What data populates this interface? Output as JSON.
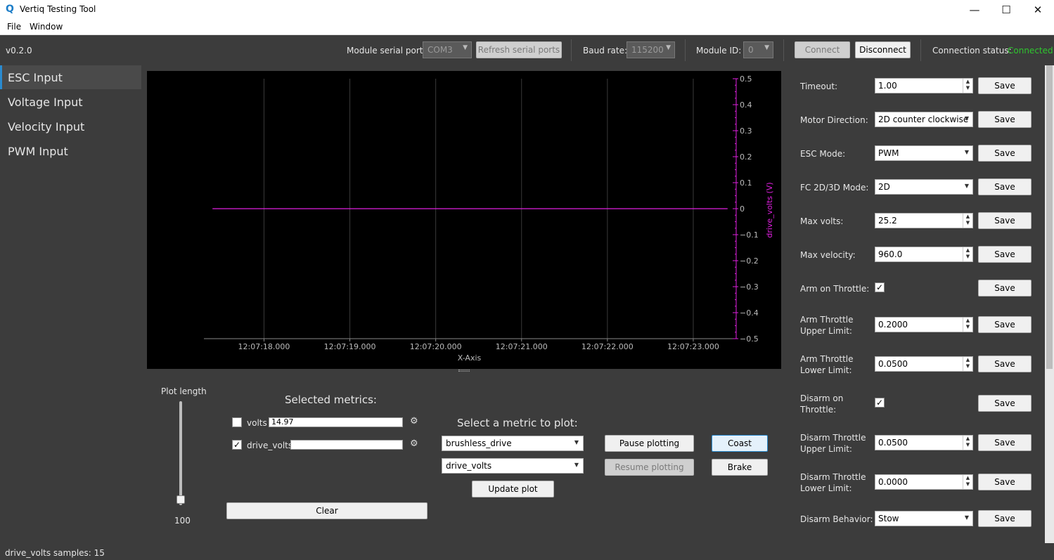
{
  "window": {
    "title": "Vertiq Testing Tool",
    "app_icon": "Q",
    "controls": {
      "minimize": "—",
      "maximize": "☐",
      "close": "✕"
    }
  },
  "menu": {
    "file": "File",
    "window": "Window"
  },
  "toolbar": {
    "version": "v0.2.0",
    "serial_port_label": "Module serial port:",
    "serial_port_value": "COM3",
    "refresh_label": "Refresh serial ports",
    "baud_label": "Baud rate:",
    "baud_value": "115200",
    "module_id_label": "Module ID:",
    "module_id_value": "0",
    "connect_label": "Connect",
    "disconnect_label": "Disconnect",
    "status_label": "Connection status:",
    "status_value": "Connected",
    "status_color": "#2ec52e"
  },
  "sidebar": {
    "items": [
      {
        "label": "ESC Input",
        "active": true
      },
      {
        "label": "Voltage Input",
        "active": false
      },
      {
        "label": "Velocity Input",
        "active": false
      },
      {
        "label": "PWM Input",
        "active": false
      }
    ],
    "accent": "#2a8bd0"
  },
  "chart_data": {
    "type": "line",
    "xlabel": "X-Axis",
    "ylabel": "drive_volts (V)",
    "x_ticks": [
      "12:07:18.000",
      "12:07:19.000",
      "12:07:20.000",
      "12:07:21.000",
      "12:07:22.000",
      "12:07:23.000"
    ],
    "y_ticks": [
      "0.5",
      "0.4",
      "0.3",
      "0.2",
      "0.1",
      "0",
      "−0.1",
      "−0.2",
      "−0.3",
      "−0.4",
      "−0.5"
    ],
    "ylim": [
      -0.5,
      0.5
    ],
    "xlim_seconds": [
      17.3,
      23.5
    ],
    "series": [
      {
        "name": "drive_volts",
        "color": "#e020e0",
        "x": [
          17.4,
          23.4
        ],
        "y": [
          0,
          0
        ]
      }
    ],
    "grid": "vertical",
    "axis_color": "#e020e0"
  },
  "controls": {
    "plot_length_label": "Plot length",
    "plot_length_value": "100",
    "plot_length_fraction": 1.0,
    "selected_metrics_title": "Selected metrics:",
    "metrics": [
      {
        "name": "volts",
        "checked": false,
        "value": "14.97"
      },
      {
        "name": "drive_volts",
        "checked": true,
        "value": ""
      }
    ],
    "clear_label": "Clear",
    "select_metric_title": "Select a metric to plot:",
    "metric_group": "brushless_drive",
    "metric_name": "drive_volts",
    "update_plot_label": "Update plot",
    "pause_label": "Pause plotting",
    "resume_label": "Resume plotting",
    "coast_label": "Coast",
    "brake_label": "Brake"
  },
  "settings": {
    "save_label": "Save",
    "timeout": {
      "label": "Timeout:",
      "value": "1.00"
    },
    "motor_direction": {
      "label": "Motor Direction:",
      "value": "2D counter clockwise"
    },
    "esc_mode": {
      "label": "ESC Mode:",
      "value": "PWM"
    },
    "fc_mode": {
      "label": "FC 2D/3D Mode:",
      "value": "2D"
    },
    "max_volts": {
      "label": "Max volts:",
      "value": "25.2"
    },
    "max_velocity": {
      "label": "Max velocity:",
      "value": "960.0"
    },
    "arm_on_throttle": {
      "label": "Arm on Throttle:",
      "checked": true
    },
    "arm_upper": {
      "label1": "Arm Throttle",
      "label2": "Upper Limit:",
      "value": "0.2000"
    },
    "arm_lower": {
      "label1": "Arm Throttle",
      "label2": "Lower Limit:",
      "value": "0.0500"
    },
    "disarm_on_throttle": {
      "label1": "Disarm on",
      "label2": "Throttle:",
      "checked": true
    },
    "disarm_upper": {
      "label1": "Disarm Throttle",
      "label2": "Upper Limit:",
      "value": "0.0500"
    },
    "disarm_lower": {
      "label1": "Disarm Throttle",
      "label2": "Lower Limit:",
      "value": "0.0000"
    },
    "disarm_behavior": {
      "label": "Disarm Behavior:",
      "value": "Stow"
    }
  },
  "statusbar": {
    "text": "drive_volts samples: 15"
  }
}
